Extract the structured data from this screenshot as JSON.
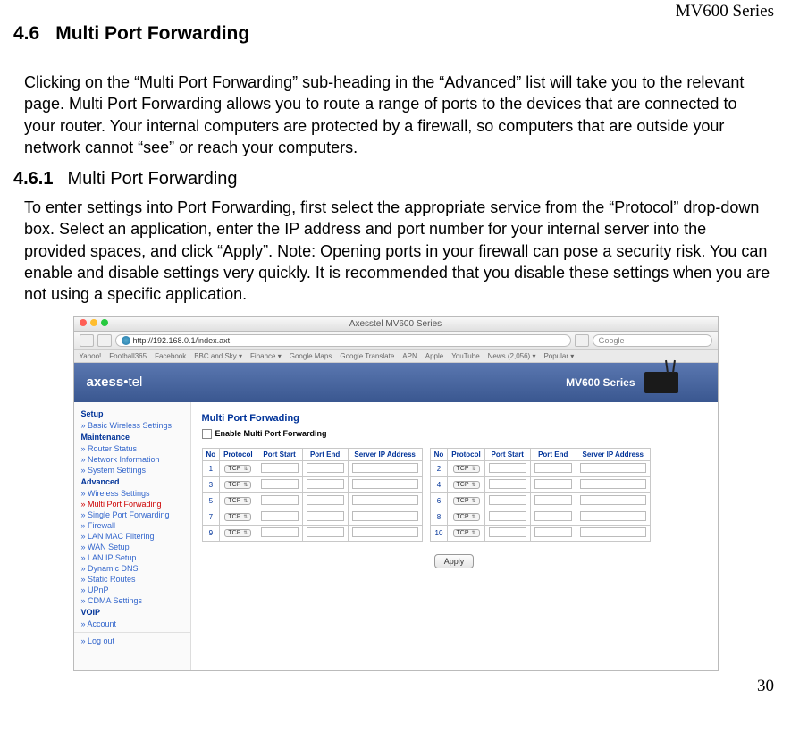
{
  "doc": {
    "series": "MV600 Series",
    "page_number": "30",
    "h2_num": "4.6",
    "h2_title": "Multi Port Forwarding",
    "p1": "Clicking on the “Multi Port Forwarding” sub-heading in the “Advanced” list will take you to the relevant page. Multi Port Forwarding allows you to route a range of ports to the devices that are connected to your router. Your internal computers are protected by a firewall, so computers that are outside your network cannot “see” or reach your computers.",
    "h3_num": "4.6.1",
    "h3_title": "Multi Port Forwarding",
    "p2": "To enter settings into Port Forwarding, first select the appropriate service from the “Protocol” drop-down box. Select an application, enter the IP address and port number for your internal server into the provided spaces, and click “Apply”. Note: Opening ports in your firewall can pose a security risk. You can enable and disable settings very quickly. It is recommended that you disable these settings when you are not using a specific application."
  },
  "browser": {
    "window_title": "Axesstel MV600 Series",
    "url": "http://192.168.0.1/index.axt",
    "search_placeholder": "Google",
    "bookmarks": [
      "Yahoo!",
      "Football365",
      "Facebook",
      "BBC and Sky ▾",
      "Finance ▾",
      "Google Maps",
      "Google Translate",
      "APN",
      "Apple",
      "YouTube",
      "News (2,056) ▾",
      "Popular ▾"
    ]
  },
  "app": {
    "logo_prefix": "axess",
    "logo_dot": "•",
    "logo_suffix": "tel",
    "series": "MV600 Series",
    "content_title": "Multi Port Forwading",
    "enable_label": "Enable Multi Port Forwarding",
    "apply_label": "Apply",
    "columns": [
      "No",
      "Protocol",
      "Port Start",
      "Port End",
      "Server IP Address"
    ],
    "rows_left": [
      {
        "no": "1"
      },
      {
        "no": "3"
      },
      {
        "no": "5"
      },
      {
        "no": "7"
      },
      {
        "no": "9"
      }
    ],
    "rows_right": [
      {
        "no": "2"
      },
      {
        "no": "4"
      },
      {
        "no": "6"
      },
      {
        "no": "8"
      },
      {
        "no": "10"
      }
    ],
    "protocol_default": "TCP"
  },
  "sidebar": {
    "groups": [
      {
        "cat": "Setup",
        "items": [
          "» Basic Wireless Settings"
        ]
      },
      {
        "cat": "Maintenance",
        "items": [
          "» Router Status",
          "» Network Information",
          "» System Settings"
        ]
      },
      {
        "cat": "Advanced",
        "items": [
          "» Wireless Settings",
          "» Multi Port Forwading",
          "» Single Port Forwarding",
          "» Firewall",
          "» LAN MAC Filtering",
          "» WAN Setup",
          "» LAN IP Setup",
          "» Dynamic DNS",
          "» Static Routes",
          "» UPnP",
          "» CDMA Settings"
        ],
        "active_index": 1
      },
      {
        "cat": "VOIP",
        "items": [
          "» Account"
        ]
      }
    ],
    "logout": "» Log out"
  }
}
